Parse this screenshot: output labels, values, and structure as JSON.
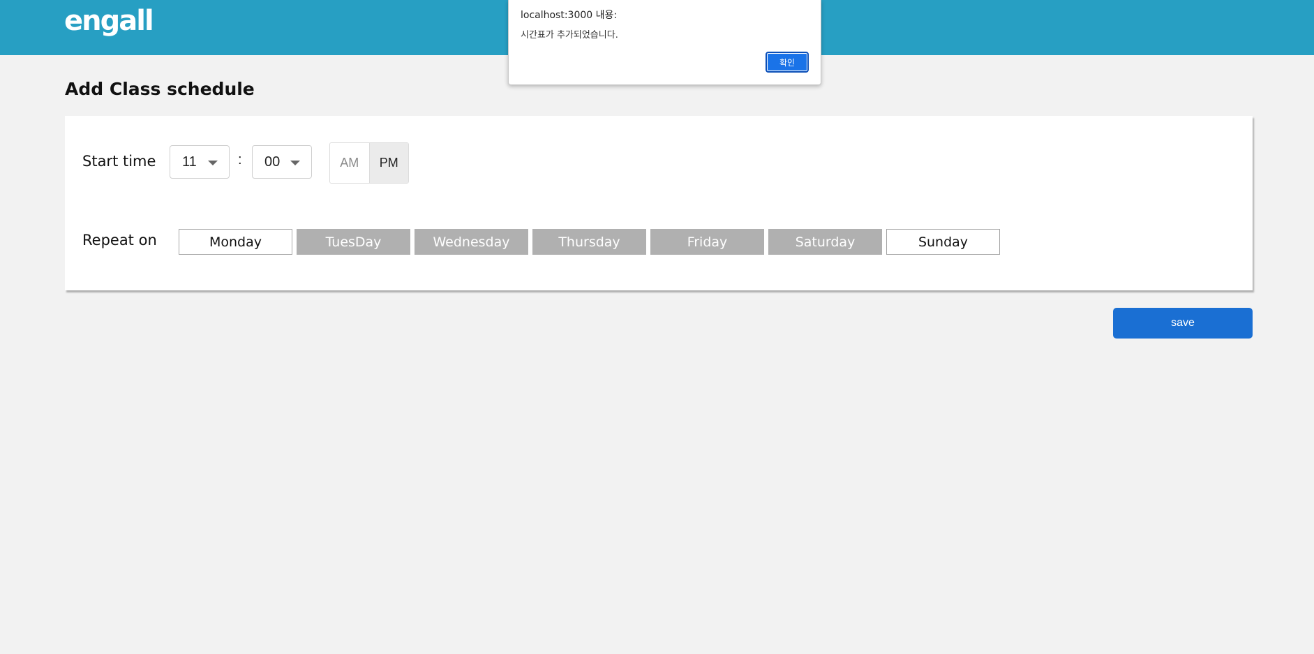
{
  "app": {
    "logo_text": "engall",
    "header_color": "#279fc3"
  },
  "page": {
    "title": "Add Class schedule"
  },
  "start_time": {
    "label": "Start time",
    "hour": "11",
    "separator": ":",
    "minute": "00",
    "am_label": "AM",
    "pm_label": "PM",
    "selected_period": "PM"
  },
  "repeat": {
    "label": "Repeat on",
    "days": [
      {
        "label": "Monday",
        "selected": false
      },
      {
        "label": "TuesDay",
        "selected": true
      },
      {
        "label": "Wednesday",
        "selected": true
      },
      {
        "label": "Thursday",
        "selected": true
      },
      {
        "label": "Friday",
        "selected": true
      },
      {
        "label": "Saturday",
        "selected": true
      },
      {
        "label": "Sunday",
        "selected": false
      }
    ],
    "selected_color": "#b0b0b0"
  },
  "actions": {
    "save_label": "save",
    "save_color": "#1a6fd3"
  },
  "alert": {
    "title": "localhost:3000 내용:",
    "message": "시간표가 추가되었습니다.",
    "ok_label": "확인"
  }
}
